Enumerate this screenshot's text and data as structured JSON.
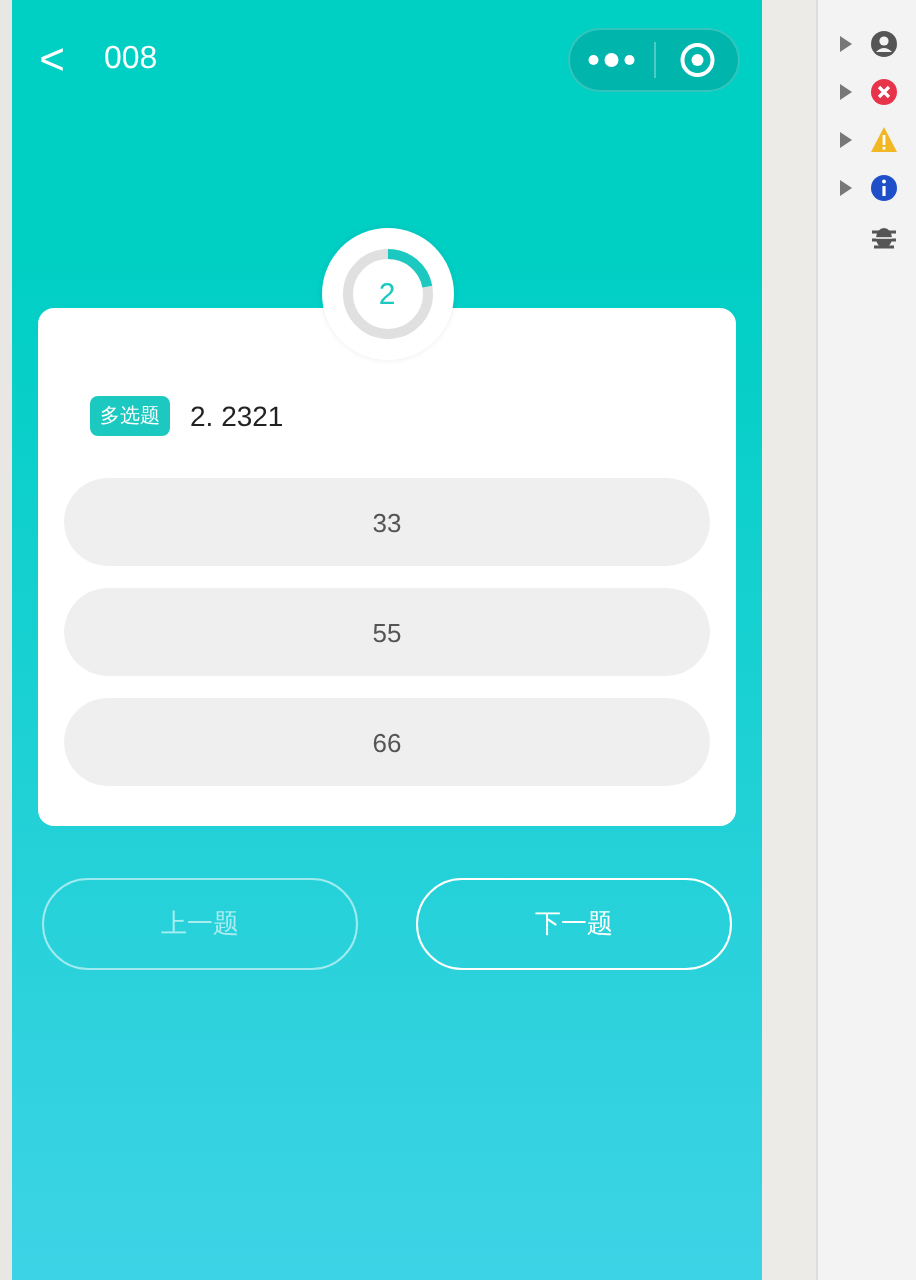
{
  "nav": {
    "back": "<",
    "title": "008"
  },
  "progress": {
    "number": "2",
    "level": 0.22
  },
  "question": {
    "tag": "多选题",
    "text": "2. 2321"
  },
  "options": [
    {
      "label": "33",
      "selected": false
    },
    {
      "label": "55",
      "selected": false
    },
    {
      "label": "66",
      "selected": false
    }
  ],
  "buttons": [
    {
      "label": "上一题",
      "disabled": true
    },
    {
      "label": "下一题",
      "disabled": false
    }
  ],
  "console_filters": [
    {
      "kind": "user",
      "expandable": true
    },
    {
      "kind": "error",
      "expandable": true
    },
    {
      "kind": "warning",
      "expandable": true
    },
    {
      "kind": "info",
      "expandable": true
    },
    {
      "kind": "bug",
      "expandable": false
    }
  ]
}
